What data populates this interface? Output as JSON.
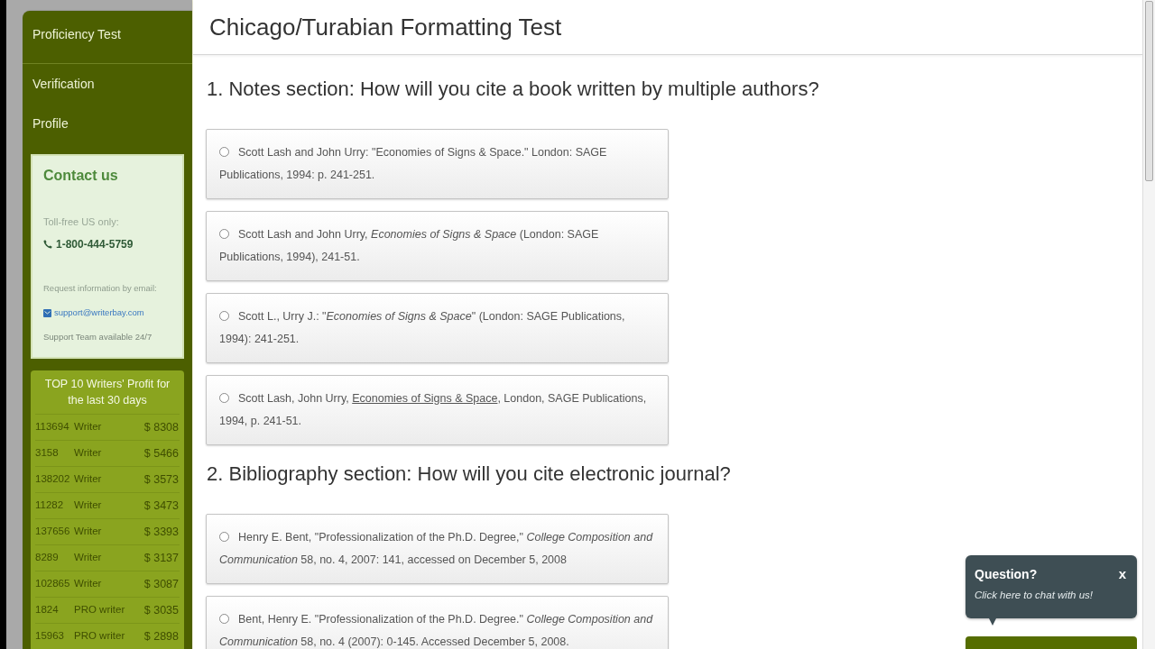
{
  "sidebar": {
    "nav_groups": [
      [
        {
          "label": "Proficiency Test"
        }
      ],
      [
        {
          "label": "Verification"
        },
        {
          "label": "Profile"
        }
      ]
    ],
    "contact": {
      "title": "Contact us",
      "phone_note": "Toll-free US only:",
      "phone": "1-800-444-5759",
      "email_note": "Request information by email:",
      "email": "support@writerbay.com",
      "support_hours": "Support Team available 24/7"
    },
    "top_writers": {
      "title": "TOP 10 Writers' Profit for the last 30 days",
      "rows": [
        {
          "id": "113694",
          "role": "Writer",
          "profit": "$ 8308"
        },
        {
          "id": "3158",
          "role": "Writer",
          "profit": "$ 5466"
        },
        {
          "id": "138202",
          "role": "Writer",
          "profit": "$ 3573"
        },
        {
          "id": "11282",
          "role": "Writer",
          "profit": "$ 3473"
        },
        {
          "id": "137656",
          "role": "Writer",
          "profit": "$ 3393"
        },
        {
          "id": "8289",
          "role": "Writer",
          "profit": "$ 3137"
        },
        {
          "id": "102865",
          "role": "Writer",
          "profit": "$ 3087"
        },
        {
          "id": "1824",
          "role": "PRO writer",
          "profit": "$ 3035"
        },
        {
          "id": "15963",
          "role": "PRO writer",
          "profit": "$ 2898"
        }
      ]
    }
  },
  "page": {
    "title": "Chicago/Turabian Formatting Test"
  },
  "questions": [
    {
      "text": "1. Notes section: How will you cite a book written by multiple authors?",
      "options": [
        {
          "selected": false,
          "parts": [
            {
              "kind": "plain",
              "text": "Scott Lash and John Urry: \"Economies of Signs & Space.\" London: SAGE Publications, 1994: p. 241-251."
            }
          ]
        },
        {
          "selected": false,
          "parts": [
            {
              "kind": "plain",
              "text": "Scott Lash and John Urry, "
            },
            {
              "kind": "italic",
              "text": "Economies of Signs & Space"
            },
            {
              "kind": "plain",
              "text": " (London: SAGE Publications, 1994), 241-51."
            }
          ]
        },
        {
          "selected": false,
          "parts": [
            {
              "kind": "plain",
              "text": "Scott L., Urry J.: \""
            },
            {
              "kind": "italic",
              "text": "Economies of Signs & Space"
            },
            {
              "kind": "plain",
              "text": "\" (London: SAGE Publications, 1994): 241-251."
            }
          ]
        },
        {
          "selected": false,
          "parts": [
            {
              "kind": "plain",
              "text": "Scott Lash, John Urry, "
            },
            {
              "kind": "underline",
              "text": "Economies of Signs & Space"
            },
            {
              "kind": "plain",
              "text": ", London, SAGE Publications, 1994, p. 241-51."
            }
          ]
        }
      ]
    },
    {
      "text": "2. Bibliography section: How will you cite electronic journal?",
      "options": [
        {
          "selected": false,
          "parts": [
            {
              "kind": "plain",
              "text": "Henry E. Bent, \"Professionalization of the Ph.D. Degree,\" "
            },
            {
              "kind": "italic",
              "text": "College Composition and Communication"
            },
            {
              "kind": "plain",
              "text": " 58, no. 4, 2007: 141, accessed on December 5, 2008"
            }
          ]
        },
        {
          "selected": false,
          "parts": [
            {
              "kind": "plain",
              "text": "Bent, Henry E. \"Professionalization of the Ph.D. Degree.\" "
            },
            {
              "kind": "italic",
              "text": "College Composition and Communication"
            },
            {
              "kind": "plain",
              "text": " 58, no. 4 (2007): 0-145. Accessed December 5, 2008."
            }
          ]
        }
      ]
    }
  ],
  "chat": {
    "title": "Question?",
    "close": "x",
    "prompt": "Click here to chat with us!"
  }
}
